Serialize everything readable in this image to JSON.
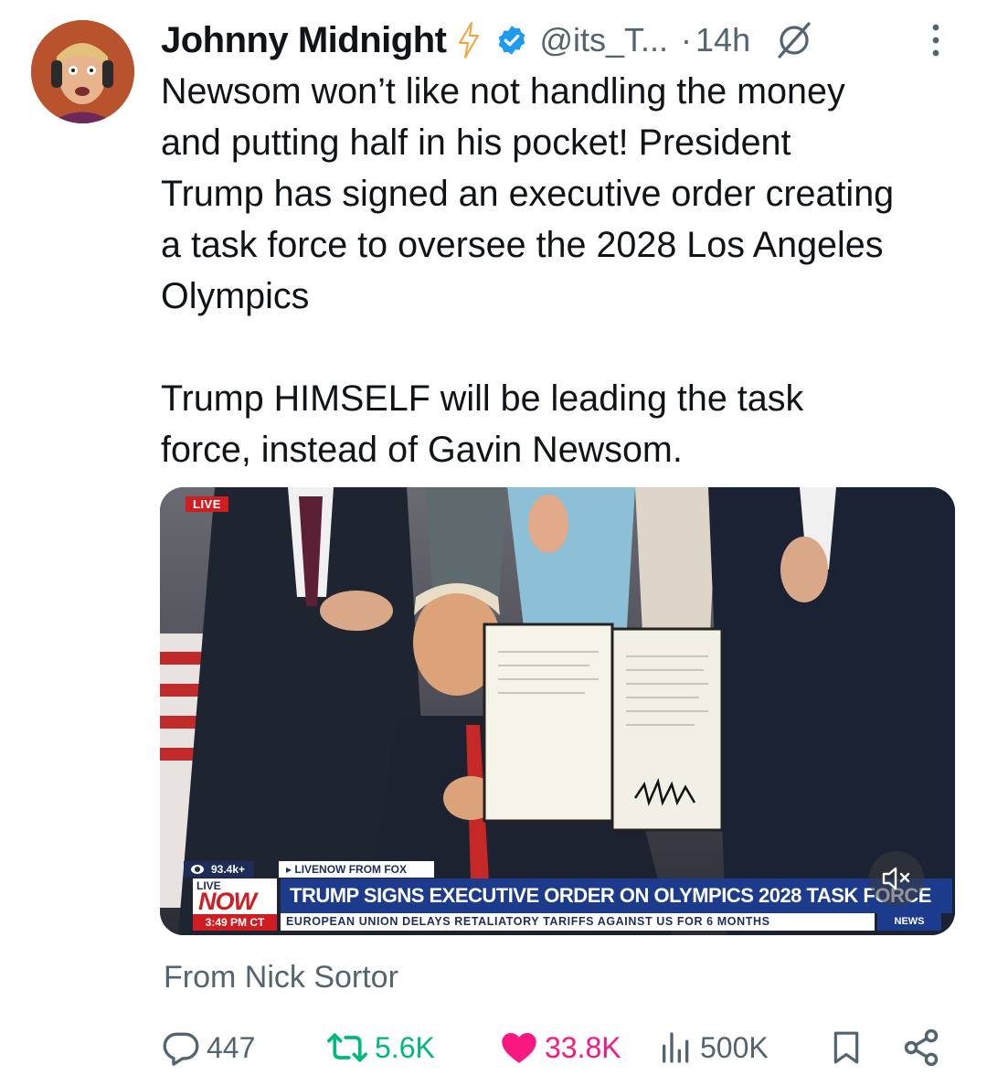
{
  "author": {
    "name": "Johnny Midnight",
    "handle": "@its_T...",
    "separator": "·",
    "time": "14h",
    "verified_color": "#1d9bf0",
    "badge_icon": "lightning-bolt-icon"
  },
  "tweet": {
    "text": "Newsom won’t like not handling the money\nand putting half in his pocket! President\nTrump has signed an executive order creating\na task force to oversee the 2028 Los Angeles\nOlympics\n\nTrump HIMSELF will be leading the task\nforce, instead of Gavin Newsom."
  },
  "media": {
    "live_label": "LIVE",
    "viewers": "93.4k+",
    "source": "LIVENOW FROM FOX",
    "now_live": "LIVE",
    "now": "NOW",
    "now_time": "3:49 PM CT",
    "headline": "TRUMP SIGNS EXECUTIVE ORDER ON OLYMPICS 2028 TASK FORCE",
    "ticker": "EUROPEAN UNION DELAYS RETALIATORY TARIFFS AGAINST US FOR 6 MONTHS",
    "news_badge": "NEWS"
  },
  "attribution": "From Nick Sortor",
  "actions": {
    "replies": "447",
    "reposts": "5.6K",
    "likes": "33.8K",
    "views": "500K"
  },
  "colors": {
    "text": "#0f1419",
    "secondary": "#536471",
    "repost_active": "#00ba7c",
    "like_active": "#f91880",
    "headline_bar": "#1c3b8c",
    "live_red": "#d01d22"
  }
}
